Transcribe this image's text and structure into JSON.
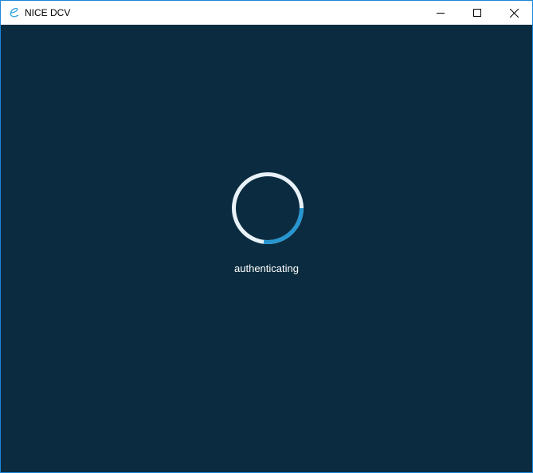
{
  "window": {
    "title": "NICE DCV",
    "icon": "nice-dcv-logo-icon",
    "controls": [
      "minimize",
      "maximize",
      "close"
    ]
  },
  "main": {
    "status_text": "authenticating",
    "spinner": {
      "track_color": "#e8f2f8",
      "progress_color": "#2696d0"
    }
  },
  "colors": {
    "background": "#0b2c40",
    "border": "#1c86d8"
  }
}
